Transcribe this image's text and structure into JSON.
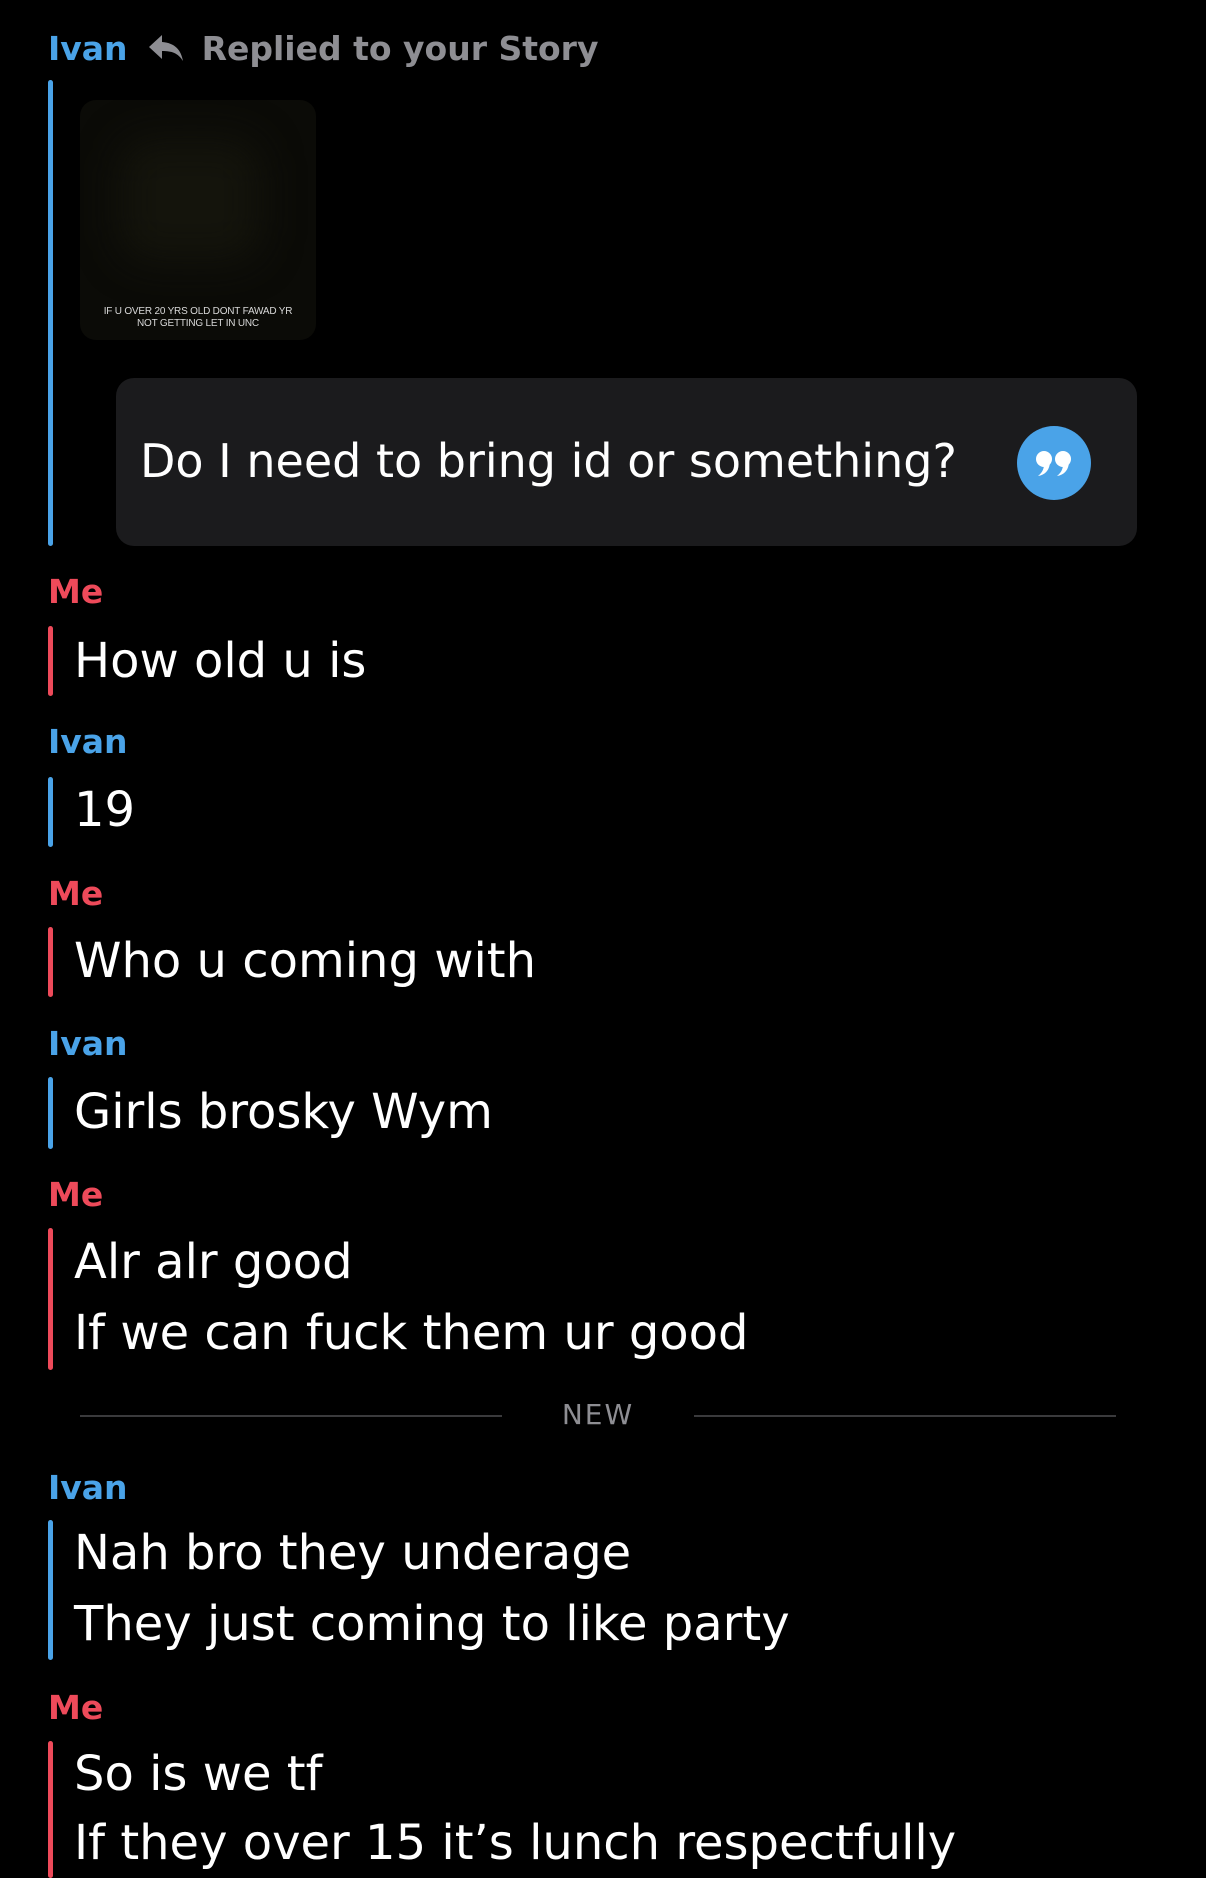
{
  "reply": {
    "sender": "Ivan",
    "action": "Replied to your Story",
    "story_caption_line1": "IF U OVER 20 YRS OLD DONT FAWAD YR",
    "story_caption_line2": "NOT GETTING LET IN UNC",
    "quoted_message": "Do I need to bring id or something?"
  },
  "messages": [
    {
      "sender": "Me",
      "lines": [
        "How old u is"
      ]
    },
    {
      "sender": "Ivan",
      "lines": [
        "19"
      ]
    },
    {
      "sender": "Me",
      "lines": [
        "Who u coming with"
      ]
    },
    {
      "sender": "Ivan",
      "lines": [
        "Girls brosky Wym"
      ]
    },
    {
      "sender": "Me",
      "lines": [
        "Alr alr good",
        "If we can fuck them ur good"
      ]
    },
    {
      "sender": "Ivan",
      "lines": [
        "Nah bro they underage",
        "They just coming to like party"
      ]
    },
    {
      "sender": "Me",
      "lines": [
        "So is we tf",
        "If they over 15 it’s lunch respectfully"
      ]
    }
  ],
  "divider": {
    "label": "NEW"
  },
  "colors": {
    "ivan": "#4aa3e8",
    "me": "#ee4a5a",
    "background": "#000000",
    "bubble": "#1b1b1d"
  },
  "icons": [
    "reply-arrow-icon",
    "quote-icon"
  ]
}
